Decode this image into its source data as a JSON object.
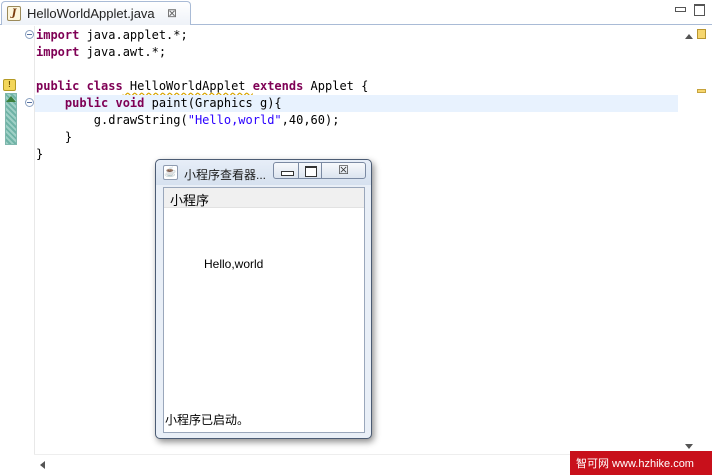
{
  "editor": {
    "tab_label": "HelloWorldApplet.java",
    "tab_icon_glyph": "J",
    "tab_close_glyph": "⊠",
    "code_lines": [
      [
        "import",
        " java.applet.*;"
      ],
      [
        "import",
        " java.awt.*;"
      ],
      [
        "",
        ""
      ],
      [
        "public class",
        " HelloWorldApplet ",
        "extends",
        " Applet {"
      ],
      [
        "    public void",
        " paint(Graphics g){"
      ],
      [
        "        g.drawString(",
        "\"Hello,world\"",
        ",40,60);"
      ],
      [
        "    }",
        ""
      ],
      [
        "}",
        ""
      ]
    ],
    "warning_icon": "warning-icon",
    "colors": {
      "keyword": "#7f0055",
      "string": "#2a00ff",
      "current_line": "#e8f2fe",
      "warning": "#f6d66e"
    }
  },
  "applet_viewer": {
    "title": "小程序查看器...",
    "java_icon_glyph": "☕",
    "close_glyph": "☒",
    "menu_label": "小程序",
    "drawn_text": "Hello,world",
    "status": "小程序已启动。"
  },
  "watermark": {
    "text": "智可网 www.hzhike.com",
    "color": "#c8101b"
  }
}
